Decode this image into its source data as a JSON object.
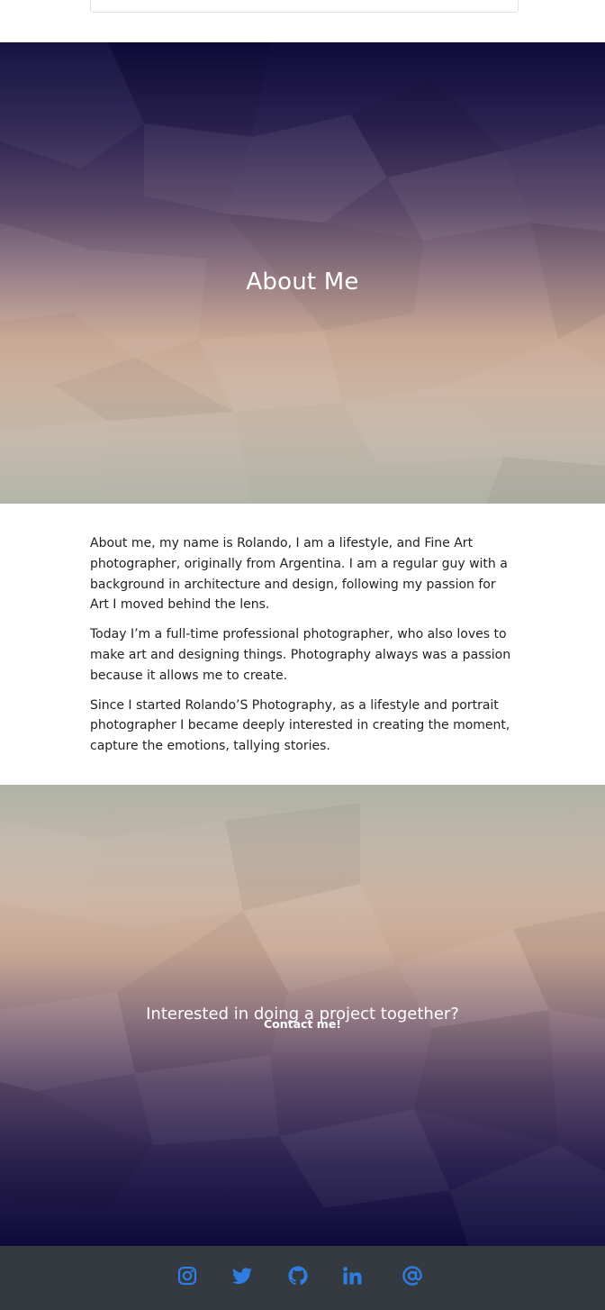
{
  "hero": {
    "title": "About Me"
  },
  "about": {
    "paragraphs": [
      "About me, my name is Rolando, I am a lifestyle, and Fine Art photographer, originally from Argentina. I am a regular guy with a background in architecture and design, following my passion for Art I moved behind the lens.",
      "Today I’m a full-time professional photographer, who also loves to make art and designing things. Photography always was a passion because it allows me to create.",
      "Since I started Rolando’S Photography, as a lifestyle and portrait photographer I became deeply interested in creating the moment, capture the emotions, tallying stories."
    ]
  },
  "cta": {
    "heading": "Interested in doing a project together?",
    "link_label": "Contact me!"
  },
  "footer": {
    "icon_color": "#2f7de1",
    "social": [
      {
        "icon": "instagram-icon"
      },
      {
        "icon": "twitter-icon"
      },
      {
        "icon": "github-icon"
      },
      {
        "icon": "linkedin-icon"
      },
      {
        "icon": "at-sign-icon"
      }
    ]
  },
  "colors": {
    "footer_bg": "#343a40",
    "hero_top": "#0e0a3a",
    "hero_bottom": "#b0b3a6"
  }
}
